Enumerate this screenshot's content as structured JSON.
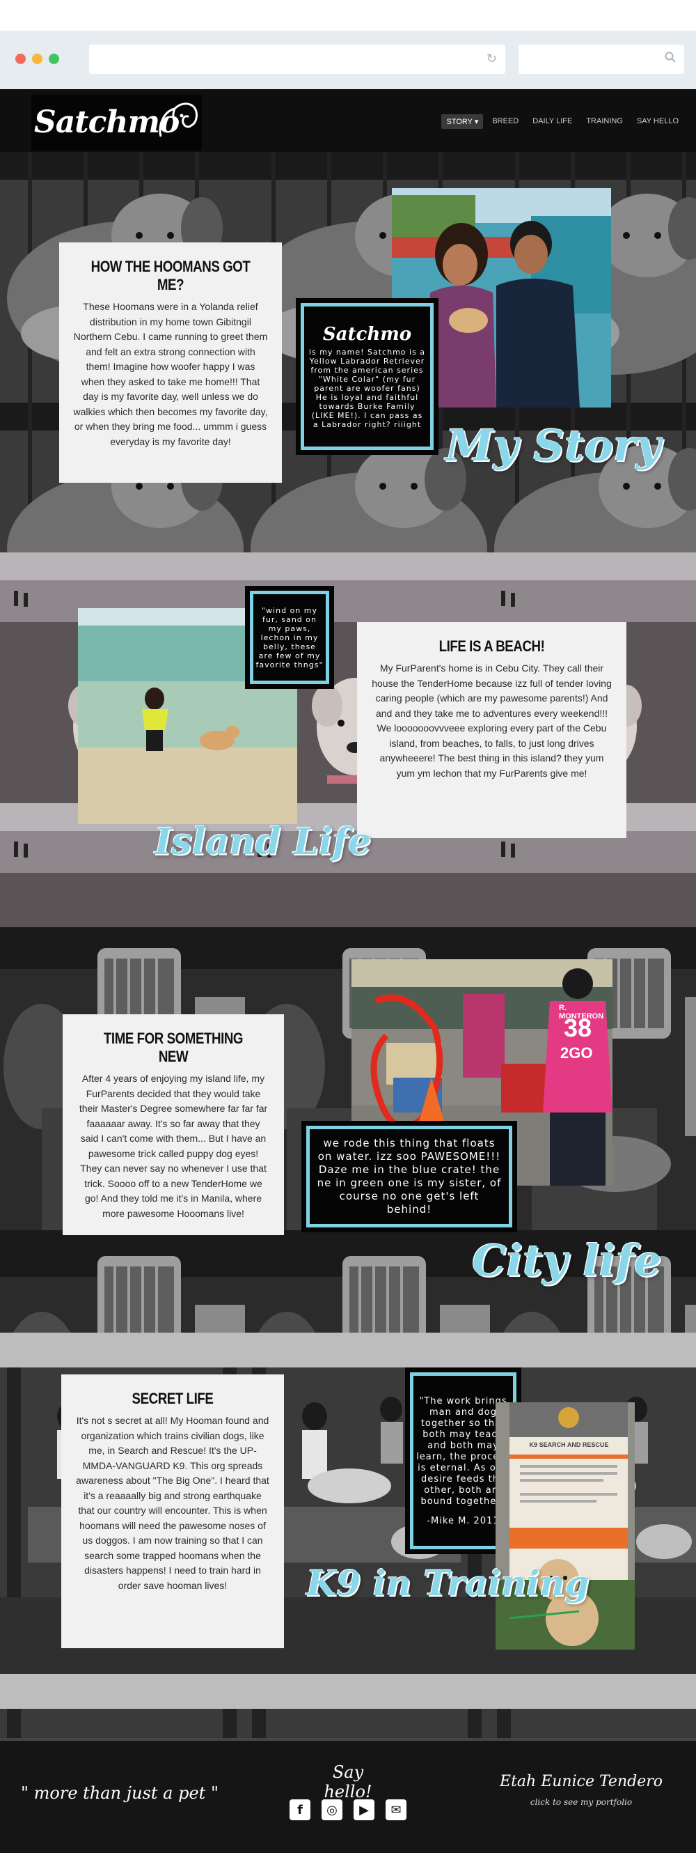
{
  "browser": {
    "reload_icon": "reload-icon",
    "search_icon": "search-icon"
  },
  "nav": {
    "logo_text": "Satchmo",
    "items": [
      {
        "label": "STORY ▾",
        "active": true
      },
      {
        "label": "BREED",
        "active": false
      },
      {
        "label": "DAILY LIFE",
        "active": false
      },
      {
        "label": "TRAINING",
        "active": false
      },
      {
        "label": "SAY HELLO",
        "active": false
      }
    ]
  },
  "story": {
    "title": "HOW THE HOOMANS GOT ME?",
    "body": "These Hoomans were in a Yolanda relief distribution in my home town Gibitngil Northern Cebu. I came running to greet them and felt an extra strong connection with them! Imagine how woofer happy I was when they asked to take me home!!! That day is my favorite day, well unless we do walkies which then becomes my favorite day, or when they bring me food... ummm i guess everyday is my favorite day!",
    "quote_logo": "Satchmo",
    "quote": "is my name! Satchmo is a Yellow Labrador Retriever from the american series \"White Colar\" (my fur parent are woofer fans) He is loyal and faithful towards Burke Family (LIKE ME!). I can pass as a Labrador right? riiight",
    "script": "My Story"
  },
  "island": {
    "title": "LIFE IS A BEACH!",
    "body": "My FurParent's home is in Cebu City. They call their house the TenderHome because izz full of tender loving caring people (which are my pawesome parents!) And and and they take me to adventures every weekend!!! We looooooovvveee exploring every part of the Cebu island, from beaches, to falls, to just long drives anywheeere! The best thing in this island? they yum yum ym lechon that my FurParents give me!",
    "quote": "\"wind on my fur, sand on my paws, lechon in my belly, these are few of my favorite thngs\"",
    "script": "Island Life"
  },
  "city": {
    "title": "TIME FOR SOMETHING NEW",
    "body": "After 4 years of enjoying my island life, my FurParents decided that they would take their Master's Degree somewhere far far far faaaaaar away. It's so far away that they said I can't come with them... But I have an pawesome trick called puppy dog eyes! They can never say no whenever I use that trick. Soooo off to a new TenderHome we go! And they told me it's in Manila, where more pawesome Hooomans live!",
    "quote": "we rode this thing that floats on water. izz soo PAWESOME!!! Daze me in the blue crate! the ne in green one is my sister, of course no one get's left behind!",
    "script": "City life",
    "shirt_name": "R. MONTERON",
    "shirt_number": "38",
    "shirt_logo": "2GO"
  },
  "k9": {
    "title": "SECRET LIFE",
    "body": "It's not s secret at all! My Hooman found and organization which trains civilian dogs, like me, in Search and Rescue! It's the UP-MMDA-VANGUARD K9. This org spreads awareness about \"The Big One\". I heard that it's a reaaaally big and strong earthquake that our country will encounter. This is when hoomans will need the pawesome noses of us doggos. I am now training so that I can search some trapped hoomans when the disasters happens! I need to train hard in order save hooman lives!",
    "quote": "\"The work brings man and dog together so that both may teach and both may learn, the process is eternal. As one desire feeds the other, both are bound together\"",
    "quote_author": "-Mike M. 2011",
    "script": "K9 in Training",
    "poster_title": "K9 SEARCH AND RESCUE"
  },
  "footer": {
    "tagline": "\" more than just a pet \"",
    "say_hello": "Say hello!",
    "social": [
      {
        "icon": "facebook-icon",
        "glyph": "f"
      },
      {
        "icon": "instagram-icon",
        "glyph": "◎"
      },
      {
        "icon": "youtube-icon",
        "glyph": "▶"
      },
      {
        "icon": "mail-icon",
        "glyph": "✉"
      }
    ],
    "author": "Etah Eunice Tendero",
    "portfolio": "click to see my portfolio"
  },
  "colors": {
    "accent": "#8ad7e9",
    "dark": "#0f0f0f",
    "card": "#f1f1f1"
  }
}
